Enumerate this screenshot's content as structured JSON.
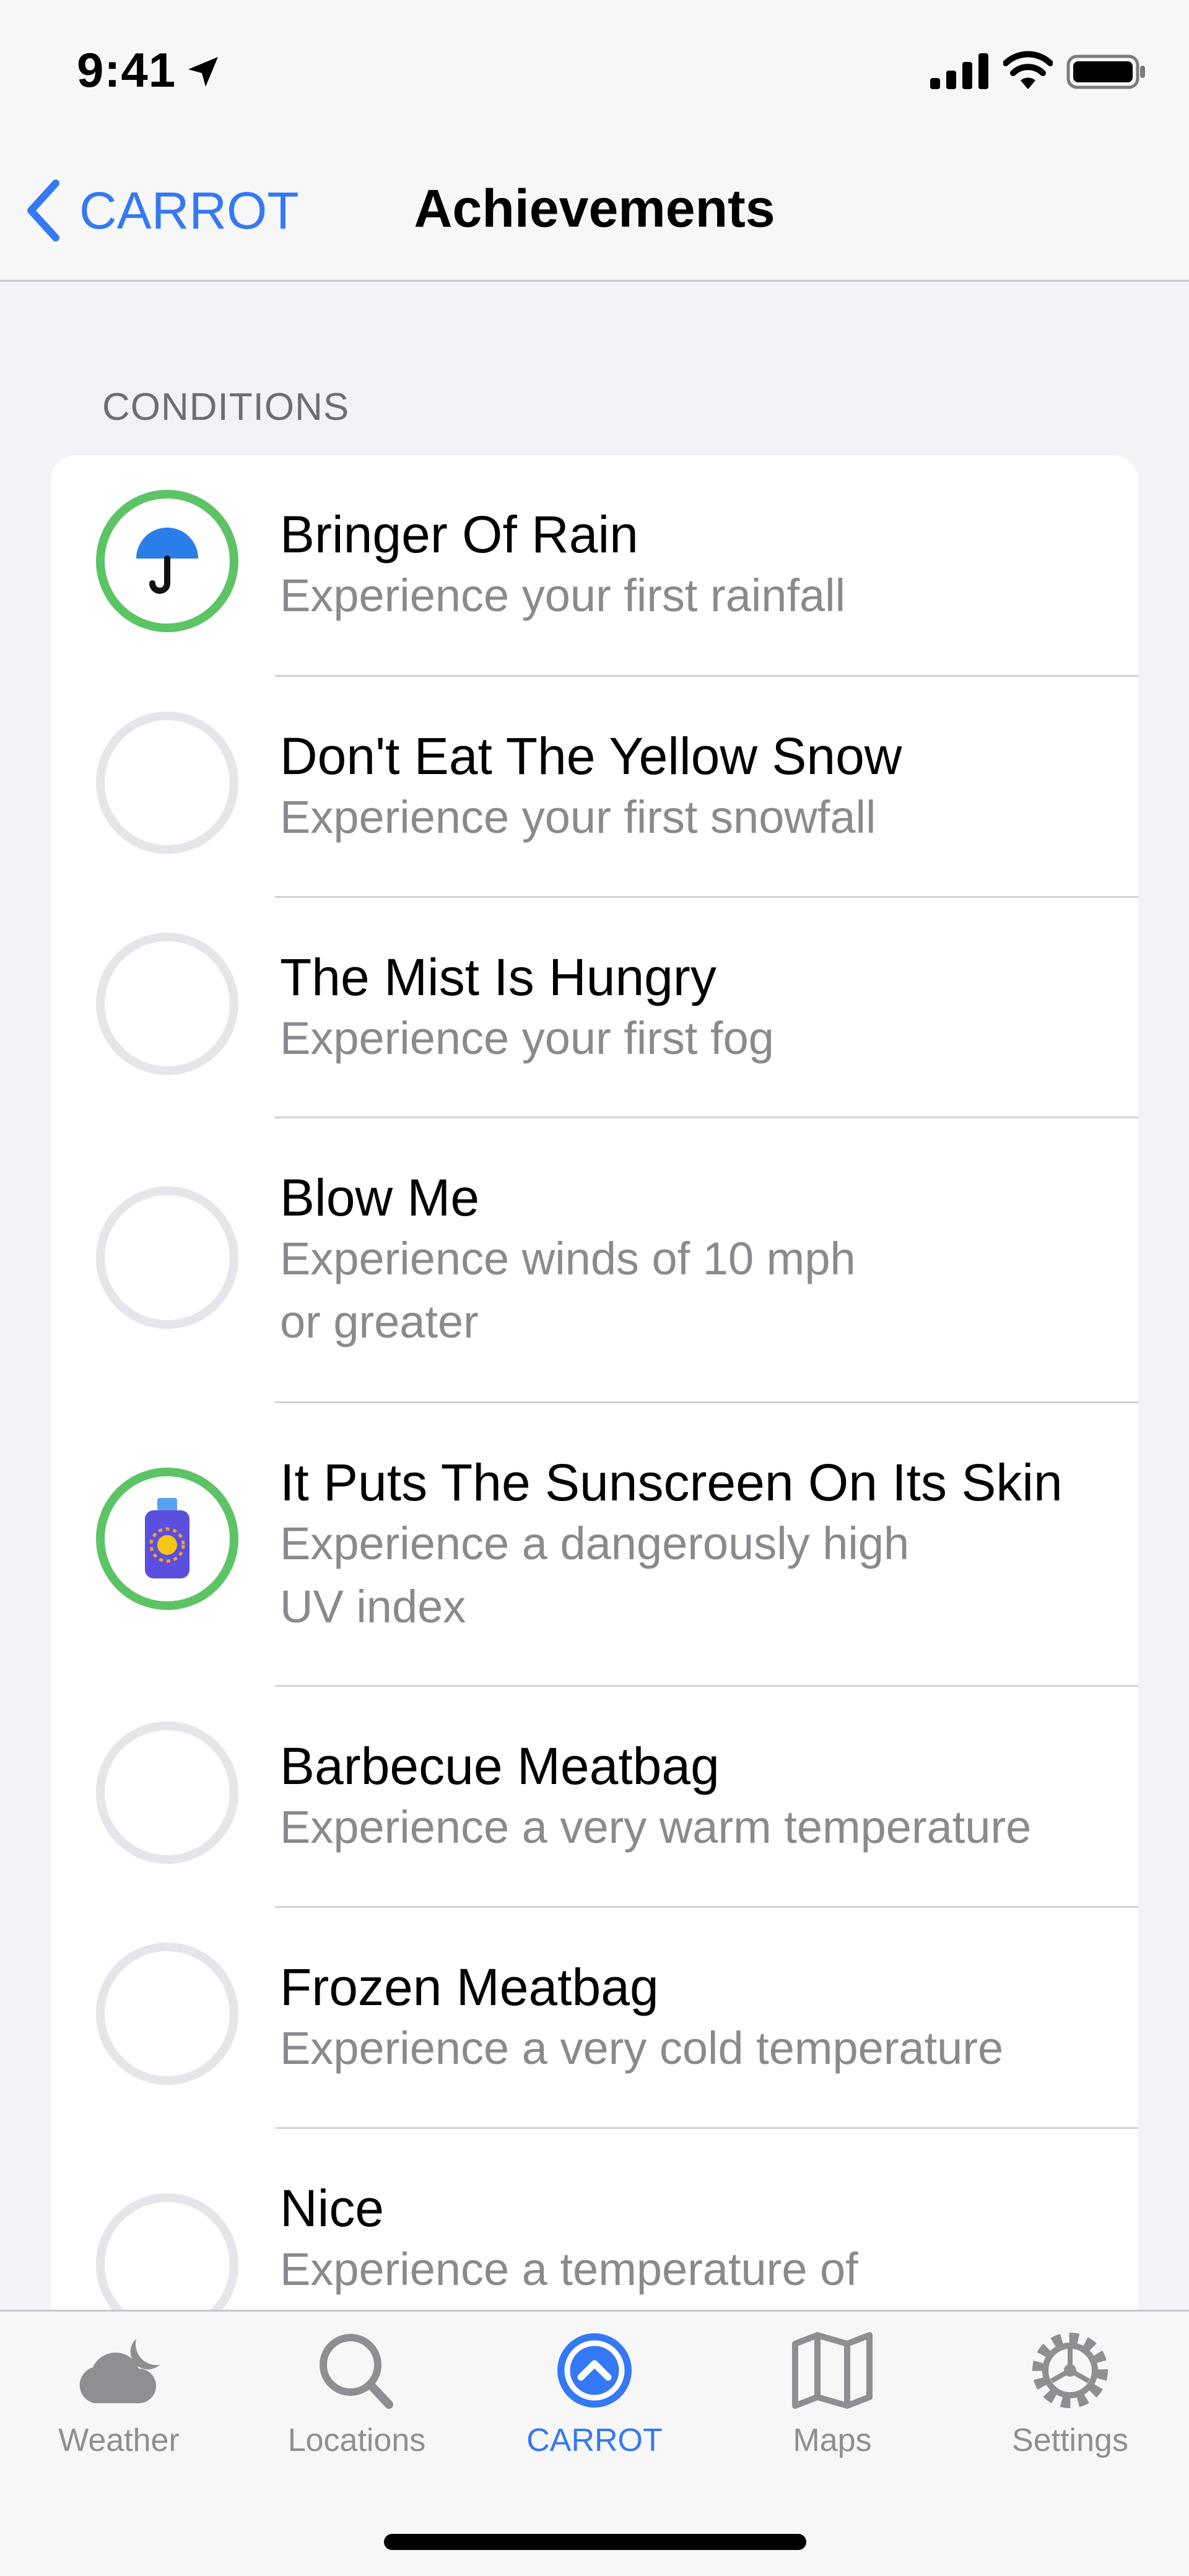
{
  "status": {
    "time": "9:41"
  },
  "nav": {
    "back_label": "CARROT",
    "title": "Achievements"
  },
  "section": {
    "header": "CONDITIONS"
  },
  "achievements": [
    {
      "title": "Bringer Of Rain",
      "desc": "Experience your first rainfall",
      "unlocked": true,
      "icon": "umbrella-icon"
    },
    {
      "title": "Don't Eat The Yellow Snow",
      "desc": "Experience your first snowfall",
      "unlocked": false
    },
    {
      "title": "The Mist Is Hungry",
      "desc": "Experience your first fog",
      "unlocked": false
    },
    {
      "title": "Blow Me",
      "desc": "Experience winds of 10 mph\nor greater",
      "unlocked": false
    },
    {
      "title": "It Puts The Sunscreen On Its Skin",
      "desc": "Experience a dangerously high\nUV index",
      "unlocked": true,
      "icon": "sunscreen-icon"
    },
    {
      "title": "Barbecue Meatbag",
      "desc": "Experience a very warm temperature",
      "unlocked": false
    },
    {
      "title": "Frozen Meatbag",
      "desc": "Experience a very cold temperature",
      "unlocked": false
    },
    {
      "title": "Nice",
      "desc": "Experience a temperature of",
      "unlocked": false
    }
  ],
  "tabs": [
    {
      "label": "Weather",
      "icon": "cloud-moon-icon"
    },
    {
      "label": "Locations",
      "icon": "search-icon"
    },
    {
      "label": "CARROT",
      "icon": "carrot-up-icon",
      "active": true
    },
    {
      "label": "Maps",
      "icon": "map-icon"
    },
    {
      "label": "Settings",
      "icon": "gear-icon"
    }
  ],
  "colors": {
    "accent": "#3478f6",
    "unlocked_ring": "#5dc466",
    "locked_ring": "#e5e5ea"
  }
}
